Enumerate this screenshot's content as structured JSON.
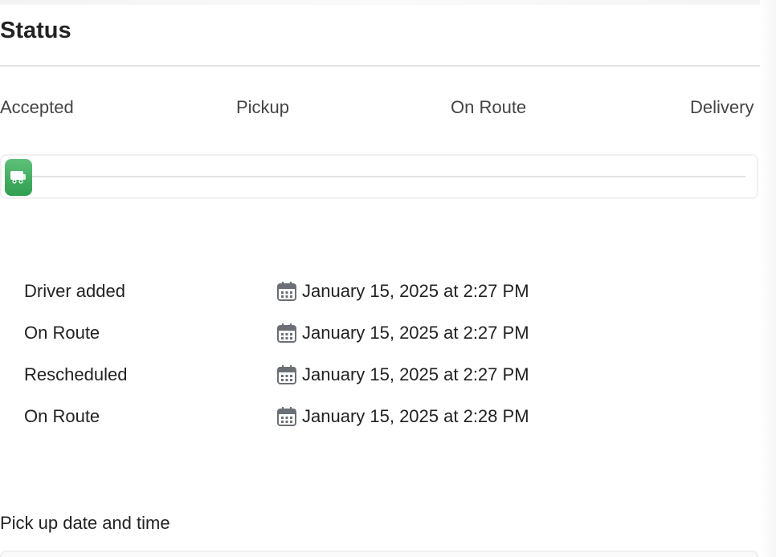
{
  "section": {
    "title": "Status"
  },
  "stages": [
    {
      "label": "Accepted"
    },
    {
      "label": "Pickup"
    },
    {
      "label": "On Route"
    },
    {
      "label": "Delivery"
    }
  ],
  "progress": {
    "value": 0,
    "accent_color": "#3aa85a",
    "icon": "truck-icon"
  },
  "timeline": [
    {
      "event": "Driver added",
      "datetime": "January 15, 2025 at 2:27 PM",
      "icon": "calendar-icon"
    },
    {
      "event": "On Route",
      "datetime": "January 15, 2025 at 2:27 PM",
      "icon": "calendar-icon"
    },
    {
      "event": "Rescheduled",
      "datetime": "January 15, 2025 at 2:27 PM",
      "icon": "calendar-icon"
    },
    {
      "event": "On Route",
      "datetime": "January 15, 2025 at 2:28 PM",
      "icon": "calendar-icon"
    }
  ],
  "pickup": {
    "label": "Pick up date and time",
    "value": ""
  }
}
